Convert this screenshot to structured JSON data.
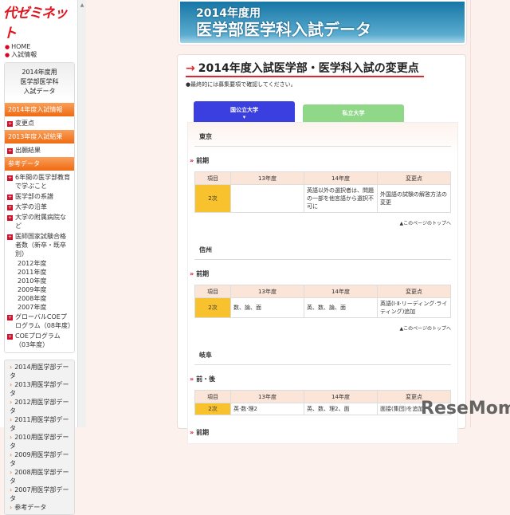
{
  "sidebar": {
    "logo": "代ゼミネット",
    "links": [
      "HOME",
      "入試情報"
    ],
    "box_title": [
      "2014年度用",
      "医学部医学科",
      "入試データ"
    ],
    "sec1": "2014年度入試情報",
    "sec1_items": [
      "変更点"
    ],
    "sec2": "2013年度入試結果",
    "sec2_items": [
      "出願結果"
    ],
    "sec3": "参考データ",
    "sec3_items": [
      "6年間の医学部教育で学ぶこと",
      "医学部の系譜",
      "大学の沿革",
      "大学の附属病院など",
      "医師国家試験合格者数（新卒・既卒別）"
    ],
    "years": [
      "2012年度",
      "2011年度",
      "2010年度",
      "2009年度",
      "2008年度",
      "2007年度"
    ],
    "sec3_items2": [
      "グローバルCOEプログラム（08年度）",
      "COEプログラム（03年度）"
    ],
    "data_links": [
      "2014用医学部データ",
      "2013用医学部データ",
      "2012用医学部データ",
      "2011用医学部データ",
      "2010用医学部データ",
      "2009用医学部データ",
      "2008用医学部データ",
      "2007用医学部データ",
      "参考データ"
    ]
  },
  "banner": {
    "line1": "2014年度用",
    "line2": "医学部医学科入試データ"
  },
  "main": {
    "title": "2014年度入試医学部・医学科入試の変更点",
    "note": "●最終的には募集要項で確認してください。",
    "tabs": [
      "国公立大学",
      "私立大学"
    ],
    "headers": [
      "項目",
      "13年度",
      "14年度",
      "変更点"
    ],
    "to_top": "▲このページのトップへ",
    "sections": [
      {
        "uni": "東京",
        "phase": "前期",
        "row": [
          "2次",
          "",
          "英語以外の選択者は、問題の一部を他言語から選択不可に",
          "外国語の試験の解答方法の変更"
        ]
      },
      {
        "uni": "信州",
        "phase": "前期",
        "row": [
          "2次",
          "数、論、面",
          "英、数、論、面",
          "英語(Ⅰ·Ⅱ·リーディング·ライティング)追加"
        ]
      },
      {
        "uni": "岐阜",
        "phase": "前・後",
        "row": [
          "2次",
          "英·数·理2",
          "英、数、理2、面",
          "面接(集団)を追加"
        ]
      }
    ],
    "next_phase": "前期"
  },
  "watermark": "ReseMom"
}
